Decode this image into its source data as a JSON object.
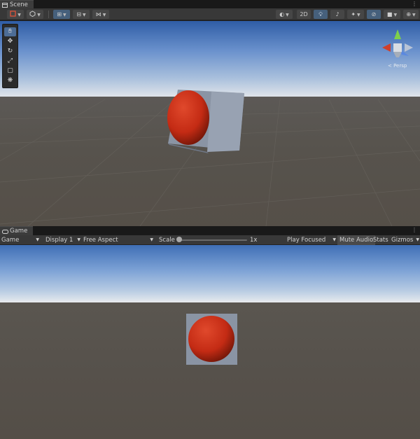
{
  "scene": {
    "tab_label": "Scene",
    "toolbar": {
      "mode_2d_label": "2D"
    },
    "tools": [
      {
        "name": "view-tool",
        "glyph": "✋",
        "active": true
      },
      {
        "name": "move-tool",
        "glyph": "✥"
      },
      {
        "name": "rotate-tool",
        "glyph": "↻"
      },
      {
        "name": "scale-tool",
        "glyph": "⤢"
      },
      {
        "name": "rect-tool",
        "glyph": "▢"
      },
      {
        "name": "transform-tool",
        "glyph": "❋"
      }
    ],
    "gizmo_label": "< Persp"
  },
  "game": {
    "tab_label": "Game",
    "display_mode": "Game",
    "display": "Display 1",
    "aspect": "Free Aspect",
    "scale_label": "Scale",
    "scale_value": "1x",
    "play_mode": "Play Focused",
    "mute_audio": "Mute Audio",
    "stats": "Stats",
    "gizmos": "Gizmos"
  },
  "colors": {
    "accent": "#46607c",
    "sphere": "#c42b14",
    "cube": "#8e98a8"
  }
}
